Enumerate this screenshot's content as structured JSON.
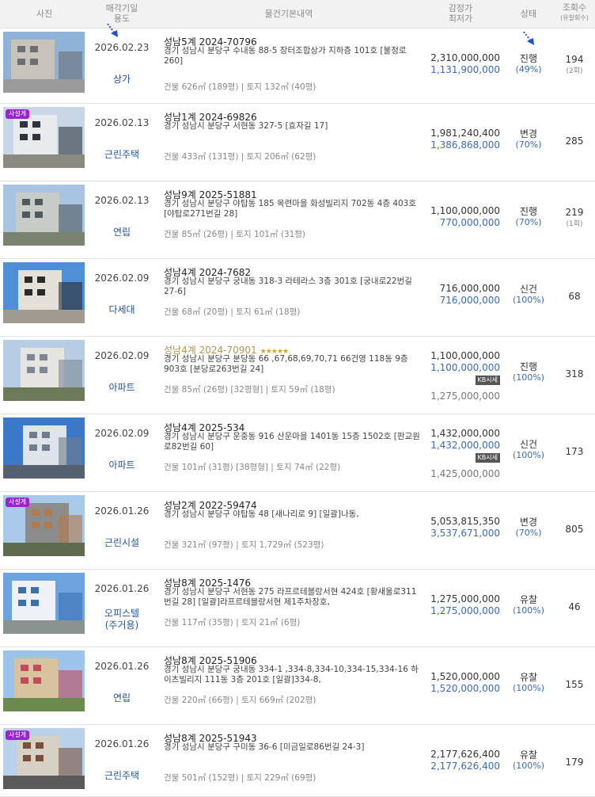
{
  "header": {
    "photo": "사진",
    "date_line1": "매각기일",
    "date_line2": "용도",
    "info": "물건기본내역",
    "price_line1": "감정가",
    "price_line2": "최저가",
    "status": "상태",
    "views_line1": "조회수",
    "views_line2": "(유찰회수)"
  },
  "items": [
    {
      "date": "2026.02.23",
      "use": "상가",
      "case_no": "성남5계 2024-70796",
      "address": "경기 성남시 분당구 수내동 88-5 장터조합상가 지하층 101호 [불정로 260]",
      "area": "건물 626㎡ (189평)  |  토지 132㎡ (40평)",
      "appraisal": "2,310,000,000",
      "minimum": "1,131,900,000",
      "status": "진행",
      "rate": "(49%)",
      "views": "194",
      "fails": "(2회)"
    },
    {
      "date": "2026.02.13",
      "use": "근린주택",
      "case_no": "성남1계 2024-69826",
      "address": "경기 성남시 분당구 서현동 327-5 [효자길 17]",
      "area": "건물 433㎡ (131평)  |  토지 206㎡ (62평)",
      "appraisal": "1,981,240,400",
      "minimum": "1,386,868,000",
      "status": "변경",
      "rate": "(70%)",
      "views": "285",
      "badge": "사설게"
    },
    {
      "date": "2026.02.13",
      "use": "연립",
      "case_no": "성남9계 2025-51881",
      "address": "경기 성남시 분당구 야탑동 185 목련마을 화성빌리지 702동 4층 403호 [야탑로271번길 28]",
      "area": "건물 85㎡ (26평)  |  토지 101㎡ (31평)",
      "appraisal": "1,100,000,000",
      "minimum": "770,000,000",
      "status": "진행",
      "rate": "(70%)",
      "views": "219",
      "fails": "(1회)"
    },
    {
      "date": "2026.02.09",
      "use": "다세대",
      "case_no": "성남4계 2024-7682",
      "address": "경기 성남시 분당구 궁내동 318-3 라테라스 3층 301호 [궁내로22번길 27-6]",
      "area": "건물 68㎡ (20평)  |  토지 61㎡ (18평)",
      "appraisal": "716,000,000",
      "minimum": "716,000,000",
      "status": "신건",
      "rate": "(100%)",
      "views": "68"
    },
    {
      "date": "2026.02.09",
      "use": "아파트",
      "case_no": "성남4계 2024-70901",
      "stars": "★★★★★",
      "address": "경기 성남시 분당구 분당동 66 ,67,68,69,70,71 66건영 118동 9층 903호 [분당로263번길 24]",
      "area": "건물 85㎡ (26평) [32평형]  |  토지 59㎡ (18평)",
      "appraisal": "1,100,000,000",
      "minimum": "1,100,000,000",
      "sise": "KB시세",
      "market": "1,275,000,000",
      "status": "진행",
      "rate": "(100%)",
      "views": "318"
    },
    {
      "date": "2026.02.09",
      "use": "아파트",
      "case_no": "성남4계 2025-534",
      "address": "경기 성남시 분당구 운중동 916 산운마을 1401동 15층 1502호 [판교원로82번길 60]",
      "area": "건물 101㎡ (31평) [38평형]  |  토지 74㎡ (22평)",
      "appraisal": "1,432,000,000",
      "minimum": "1,432,000,000",
      "sise": "KB시세",
      "market": "1,425,000,000",
      "status": "신건",
      "rate": "(100%)",
      "views": "173"
    },
    {
      "date": "2026.01.26",
      "use": "근린시설",
      "case_no": "성남2계 2022-59474",
      "address": "경기 성남시 분당구 야탑동 48 [새나리로 9] [일괄]나동,",
      "area": "건물 321㎡ (97평)  |  토지 1,729㎡ (523평)",
      "appraisal": "5,053,815,350",
      "minimum": "3,537,671,000",
      "status": "변경",
      "rate": "(70%)",
      "views": "805",
      "badge": "사설게"
    },
    {
      "date": "2026.01.26",
      "use": "오피스텔\n(주거용)",
      "case_no": "성남8계 2025-1476",
      "address": "경기 성남시 분당구 서현동 275 라프르테블랑서현 424호 [황새울로311번길 28] [일괄]라프르테블랑서현 제1주차장호,",
      "area": "건물 117㎡ (35평)  |  토지 21㎡ (6평)",
      "appraisal": "1,275,000,000",
      "minimum": "1,275,000,000",
      "status": "유찰",
      "rate": "(100%)",
      "views": "46"
    },
    {
      "date": "2026.01.26",
      "use": "연립",
      "case_no": "성남8계 2025-51906",
      "address": "경기 성남시 분당구 궁내동 334-1 ,334-8,334-10,334-15,334-16 하이츠빌리지 111동 3층 201호 [일괄]334-8,",
      "area": "건물 220㎡ (66평)  |  토지 669㎡ (202평)",
      "appraisal": "1,520,000,000",
      "minimum": "1,520,000,000",
      "status": "유찰",
      "rate": "(100%)",
      "views": "155"
    },
    {
      "date": "2026.01.26",
      "use": "근린주택",
      "case_no": "성남8계 2025-51943",
      "address": "경기 성남시 분당구 구미동 36-6 [미금일로86번길 24-3]",
      "area": "건물 501㎡ (152평)  |  토지 229㎡ (69평)",
      "appraisal": "2,177,626,400",
      "minimum": "2,177,626,400",
      "status": "유찰",
      "rate": "(100%)",
      "views": "179",
      "badge": "사설게"
    }
  ]
}
